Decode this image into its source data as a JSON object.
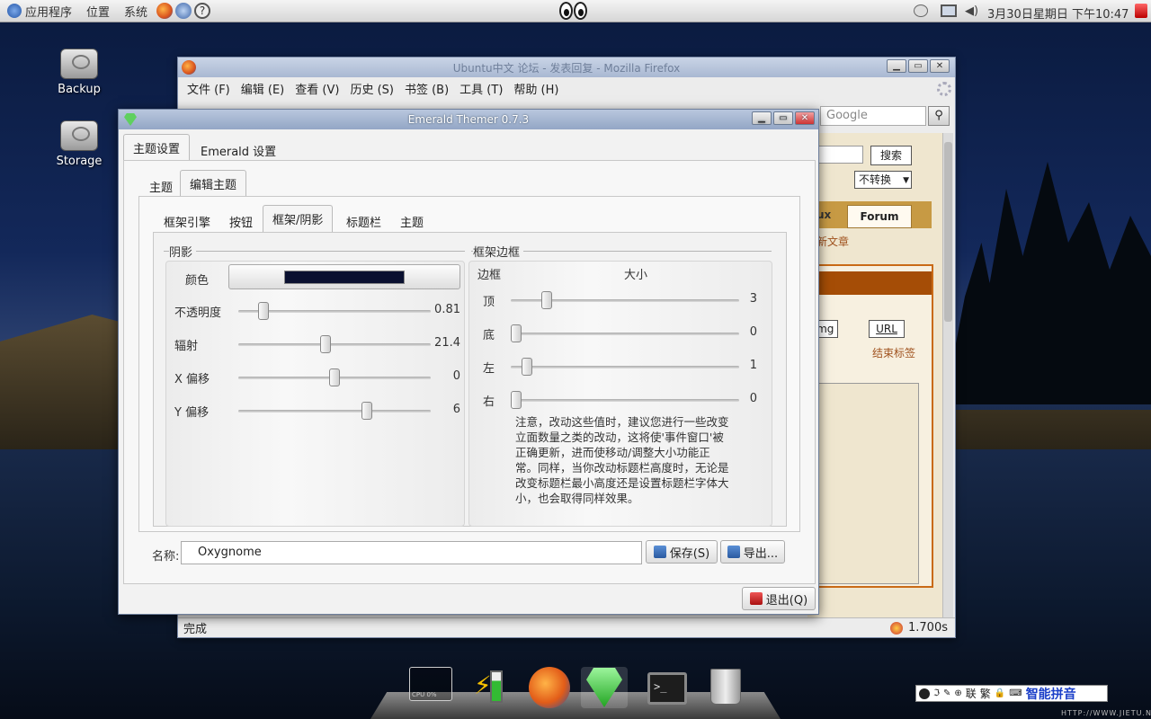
{
  "top_panel": {
    "menus": [
      "应用程序",
      "位置",
      "系统"
    ],
    "clock": "3月30日星期日 下午10:47"
  },
  "desktop": {
    "icons": [
      {
        "label": "Backup"
      },
      {
        "label": "Storage"
      }
    ]
  },
  "firefox": {
    "title": "Ubuntu中文 论坛 - 发表回复 - Mozilla Firefox",
    "menu": [
      "文件 (F)",
      "编辑 (E)",
      "查看 (V)",
      "历史 (S)",
      "书签 (B)",
      "工具 (T)",
      "帮助 (H)"
    ],
    "search_placeholder": "Google",
    "page": {
      "search_button": "搜索",
      "convert_select": "不转换",
      "tabs": [
        "ux",
        "Forum"
      ],
      "new_articles": "新文章",
      "img_button": "Img",
      "url_button": "URL",
      "close_tags": "结束标签"
    },
    "status": "完成",
    "load_time": "1.700s"
  },
  "emerald": {
    "title": "Emerald Themer 0.7.3",
    "main_tabs": [
      "主题设置",
      "Emerald 设置"
    ],
    "sub_tabs": [
      "主题",
      "编辑主题"
    ],
    "inner_tabs": [
      "框架引擎",
      "按钮",
      "框架/阴影",
      "标题栏",
      "主题"
    ],
    "shadow": {
      "group_title": "阴影",
      "color_label": "颜色",
      "color_value": "#0a1030",
      "rows": [
        {
          "label": "不透明度",
          "value": "0.81",
          "fraction": 0.11
        },
        {
          "label": "辐射",
          "value": "21.4",
          "fraction": 0.45
        },
        {
          "label": "X 偏移",
          "value": "0",
          "fraction": 0.5
        },
        {
          "label": "Y 偏移",
          "value": "6",
          "fraction": 0.68
        }
      ]
    },
    "border": {
      "group_title": "框架边框",
      "col_edge": "边框",
      "col_size": "大小",
      "rows": [
        {
          "label": "顶",
          "value": "3",
          "fraction": 0.14
        },
        {
          "label": "底",
          "value": "0",
          "fraction": 0.0
        },
        {
          "label": "左",
          "value": "1",
          "fraction": 0.05
        },
        {
          "label": "右",
          "value": "0",
          "fraction": 0.0
        }
      ],
      "note": "注意，改动这些值时，建议您进行一些改变立面数量之类的改动，这将使'事件窗口'被正确更新，进而使移动/调整大小功能正常。同样，当你改动标题栏高度时，无论是改变标题栏最小高度还是设置标题栏字体大小，也会取得同样效果。"
    },
    "name_label": "名称:",
    "name_value": "Oxygnome",
    "save_button": "保存(S)",
    "export_button": "导出...",
    "quit_button": "退出(Q)"
  },
  "dock": {
    "cpu_label": "CPU 0%"
  },
  "ime": {
    "label": "智能拼音",
    "mode_chars": [
      "联",
      "繁"
    ]
  },
  "watermark": "HTTP://WWW.JIETU.NET/"
}
